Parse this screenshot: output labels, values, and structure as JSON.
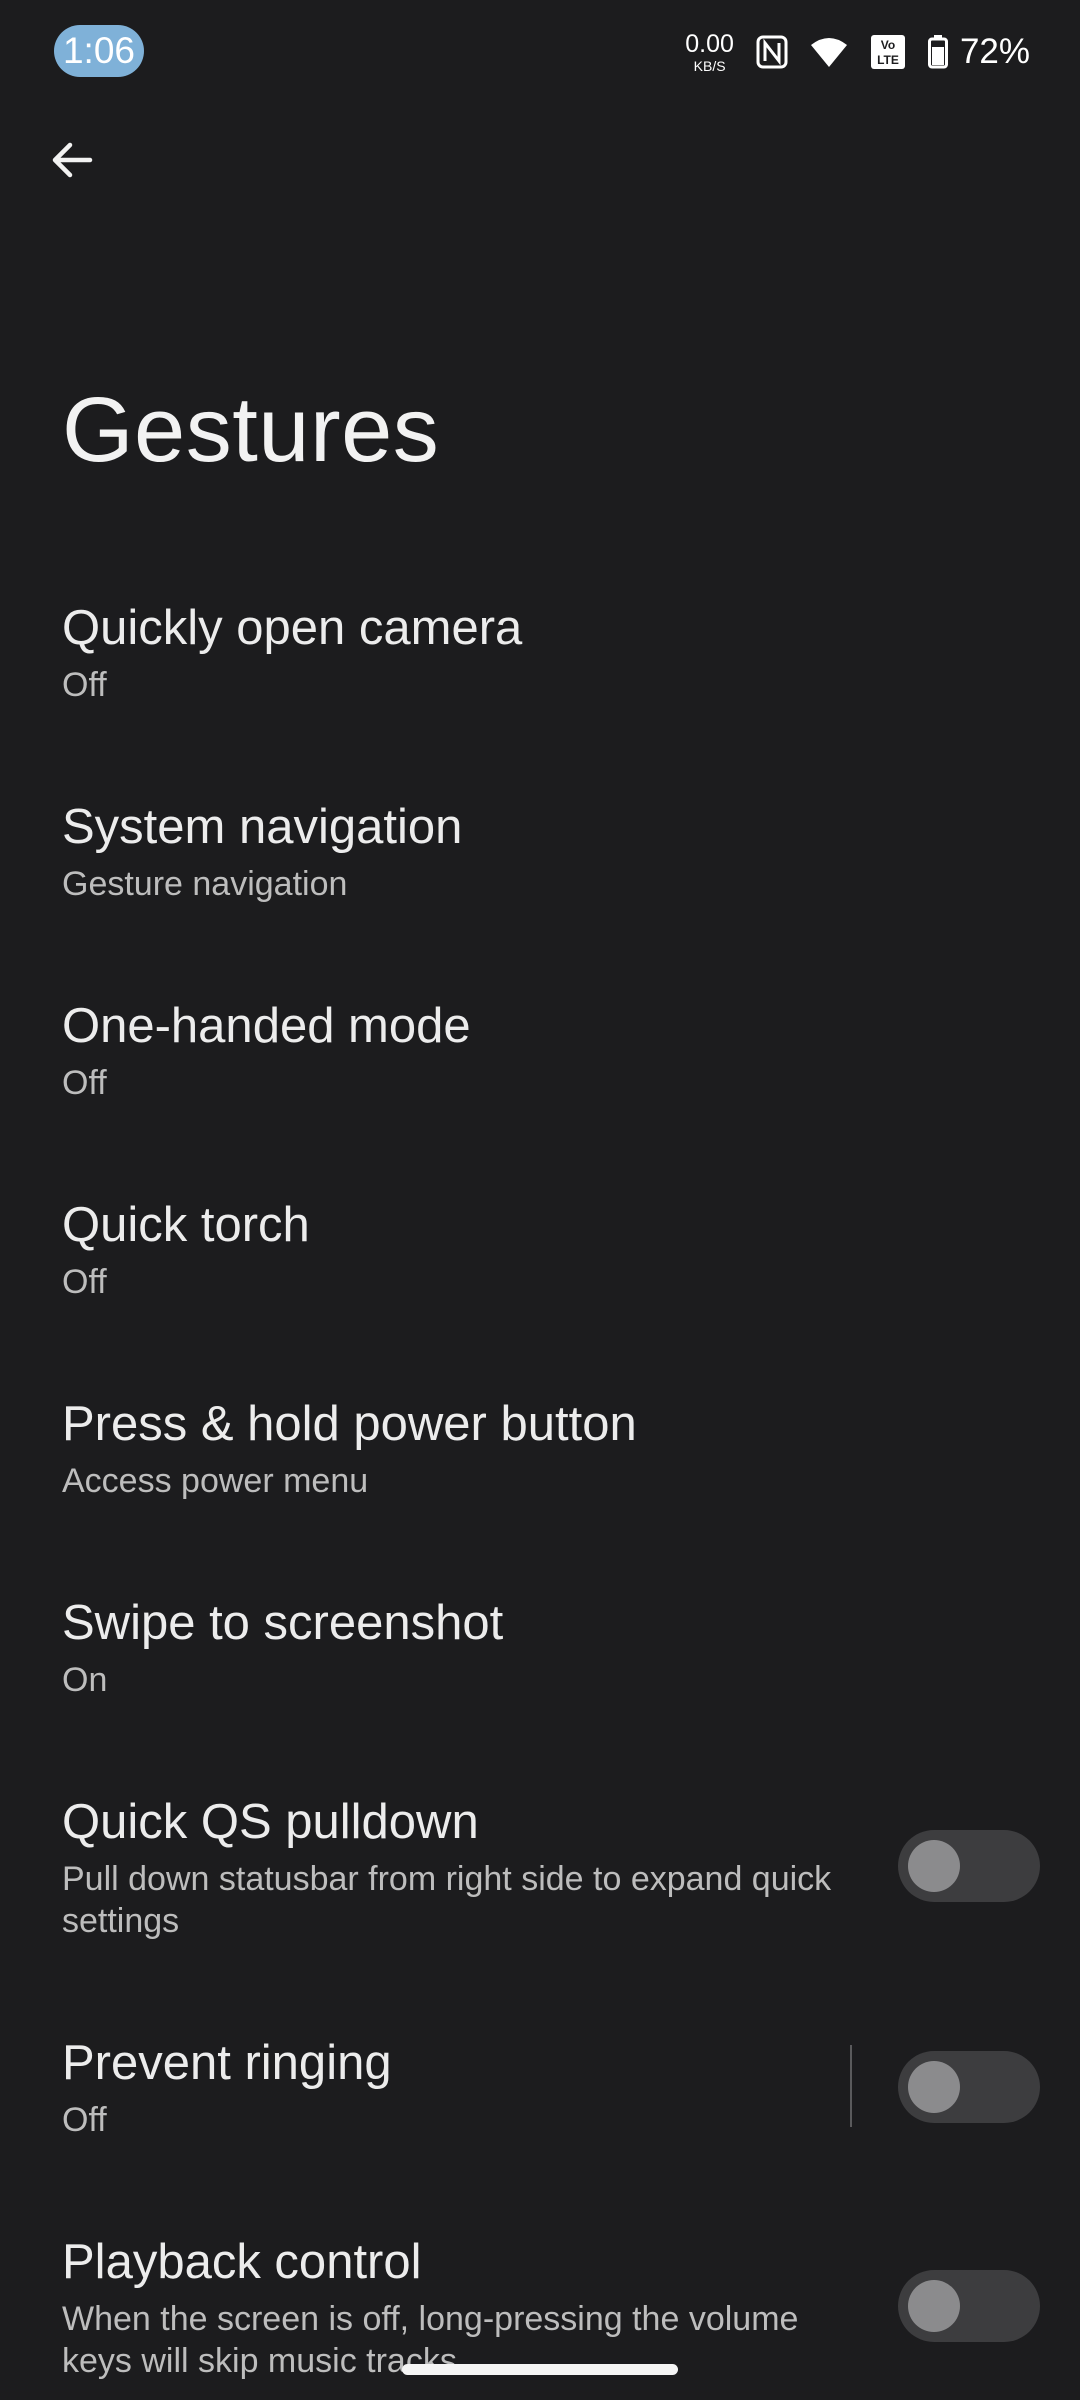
{
  "status_bar": {
    "time": "1:06",
    "net_speed_value": "0.00",
    "net_speed_unit": "KB/S",
    "battery_percent": "72%",
    "icons": [
      "nfc-icon",
      "wifi-icon",
      "volte-icon",
      "battery-icon"
    ]
  },
  "page": {
    "title": "Gestures"
  },
  "settings": [
    {
      "title": "Quickly open camera",
      "summary": "Off"
    },
    {
      "title": "System navigation",
      "summary": "Gesture navigation"
    },
    {
      "title": "One-handed mode",
      "summary": "Off"
    },
    {
      "title": "Quick torch",
      "summary": "Off"
    },
    {
      "title": "Press & hold power button",
      "summary": "Access power menu"
    },
    {
      "title": "Swipe to screenshot",
      "summary": "On"
    },
    {
      "title": "Quick QS pulldown",
      "summary": "Pull down statusbar from right side to expand quick settings",
      "toggle": false
    },
    {
      "title": "Prevent ringing",
      "summary": "Off",
      "toggle": false
    },
    {
      "title": "Playback control",
      "summary": "When the screen is off, long-pressing the volume keys will skip music tracks",
      "toggle": false
    }
  ],
  "colors": {
    "background": "#1c1c1e",
    "clock_pill": "#7fb1d8",
    "toggle_track_off": "#3d3d3f",
    "toggle_knob_off": "#8b8b8d"
  }
}
